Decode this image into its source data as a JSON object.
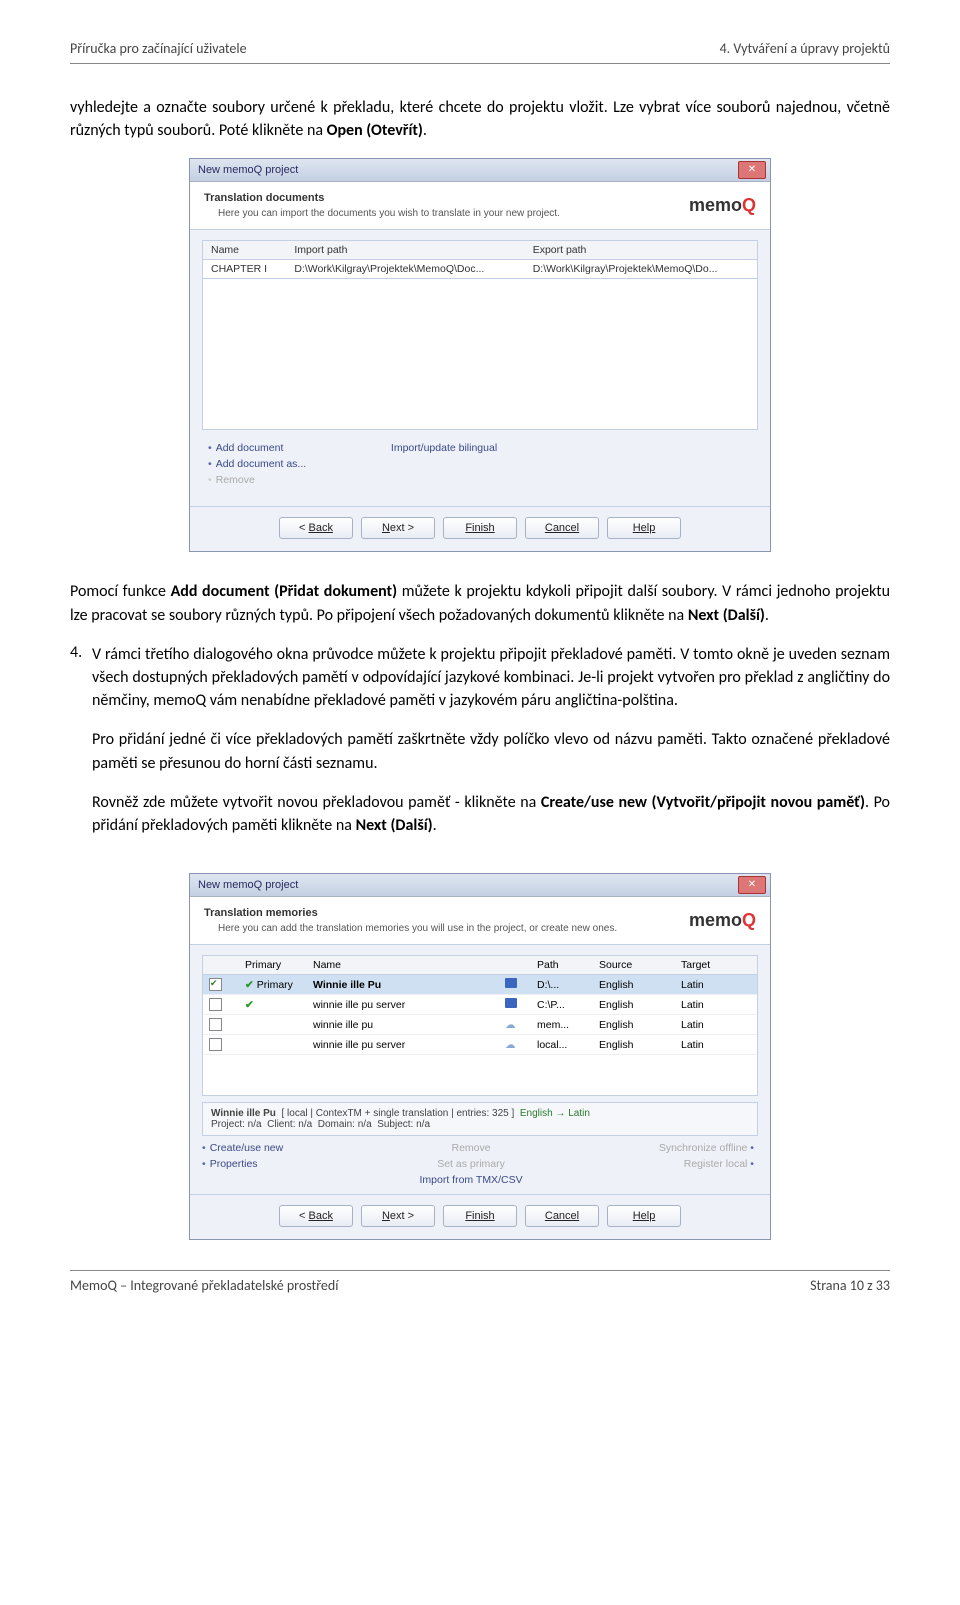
{
  "header": {
    "left": "Příručka pro začínající uživatele",
    "right": "4. Vytváření a úpravy projektů"
  },
  "para1_a": "vyhledejte a označte soubory určené k překladu, které chcete do projektu vložit. Lze vybrat více souborů najednou, včetně různých typů souborů. Poté klikněte na ",
  "para1_b": "Open (Otevřít)",
  "para1_c": ".",
  "dlg1": {
    "title": "New memoQ project",
    "h1": "Translation documents",
    "h2": "Here you can import the documents you wish to translate in your new project.",
    "cols": {
      "name": "Name",
      "import": "Import path",
      "export": "Export path"
    },
    "row": {
      "name": "CHAPTER I",
      "import": "D:\\Work\\Kilgray\\Projektek\\MemoQ\\Doc...",
      "export": "D:\\Work\\Kilgray\\Projektek\\MemoQ\\Do..."
    },
    "links": {
      "add": "Add document",
      "addas": "Add document as...",
      "remove": "Remove",
      "bilingual": "Import/update bilingual"
    },
    "btns": {
      "back": "Back",
      "next": "Next >",
      "finish": "Finish",
      "cancel": "Cancel",
      "help": "Help"
    }
  },
  "para2_a": "Pomocí funkce ",
  "para2_b": "Add document (Přidat dokument)",
  "para2_c": " můžete k projektu kdykoli připojit další soubory. V rámci jednoho projektu lze pracovat se soubory různých typů. Po připojení všech požadovaných dokumentů klikněte na ",
  "para2_d": "Next (Další)",
  "para2_e": ".",
  "item4": {
    "num": "4.",
    "a": "V rámci třetího dialogového okna průvodce můžete k projektu připojit překladové paměti. V tomto okně je uveden seznam všech dostupných překladových pamětí v odpovídající jazykové kombinaci. Je-li projekt vytvořen pro překlad z angličtiny do němčiny, memoQ vám nenabídne překladové paměti v jazykovém páru angličtina-polština.",
    "b": "Pro přidání jedné či více překladových pamětí zaškrtněte vždy políčko vlevo od názvu paměti. Takto označené překladové paměti se přesunou do horní části seznamu.",
    "c1": "Rovněž zde můžete vytvořit novou překladovou paměť - klikněte na ",
    "c2": "Create/use new (Vytvořit/připojit novou paměť)",
    "c3": ". Po přidání překladových paměti klikněte na ",
    "c4": "Next (Další)",
    "c5": "."
  },
  "dlg2": {
    "title": "New memoQ project",
    "h1": "Translation memories",
    "h2": "Here you can add the translation memories you will use in the project, or create new ones.",
    "cols": {
      "chk": "",
      "primary": "Primary",
      "name": "Name",
      "ic": "",
      "path": "Path",
      "source": "Source",
      "target": "Target"
    },
    "rows": [
      {
        "checked": true,
        "primary": "Primary",
        "name": "Winnie ille Pu",
        "icon": "disk",
        "path": "D:\\...",
        "source": "English",
        "target": "Latin"
      },
      {
        "checked": false,
        "primary": "",
        "name": "winnie ille pu server",
        "icon": "disk",
        "path": "C:\\P...",
        "source": "English",
        "target": "Latin"
      },
      {
        "checked": false,
        "primary": "",
        "name": "winnie ille pu",
        "icon": "cloud",
        "path": "mem...",
        "source": "English",
        "target": "Latin"
      },
      {
        "checked": false,
        "primary": "",
        "name": "winnie ille pu server",
        "icon": "cloud",
        "path": "local...",
        "source": "English",
        "target": "Latin"
      }
    ],
    "info": "Winnie ille Pu  [ local | ContexTM + single translation | entries: 325 ]  English → Latin\nProject: n/a  Client: n/a  Domain: n/a  Subject: n/a",
    "info_langs": "English → Latin",
    "links": {
      "create": "Create/use new",
      "props": "Properties",
      "remove": "Remove",
      "setprim": "Set as primary",
      "import": "Import from TMX/CSV",
      "sync": "Synchronize offline",
      "reg": "Register local"
    },
    "btns": {
      "back": "Back",
      "next": "Next >",
      "finish": "Finish",
      "cancel": "Cancel",
      "help": "Help"
    }
  },
  "footer": {
    "left": "MemoQ – Integrované překladatelské prostředí",
    "right": "Strana 10 z 33"
  }
}
